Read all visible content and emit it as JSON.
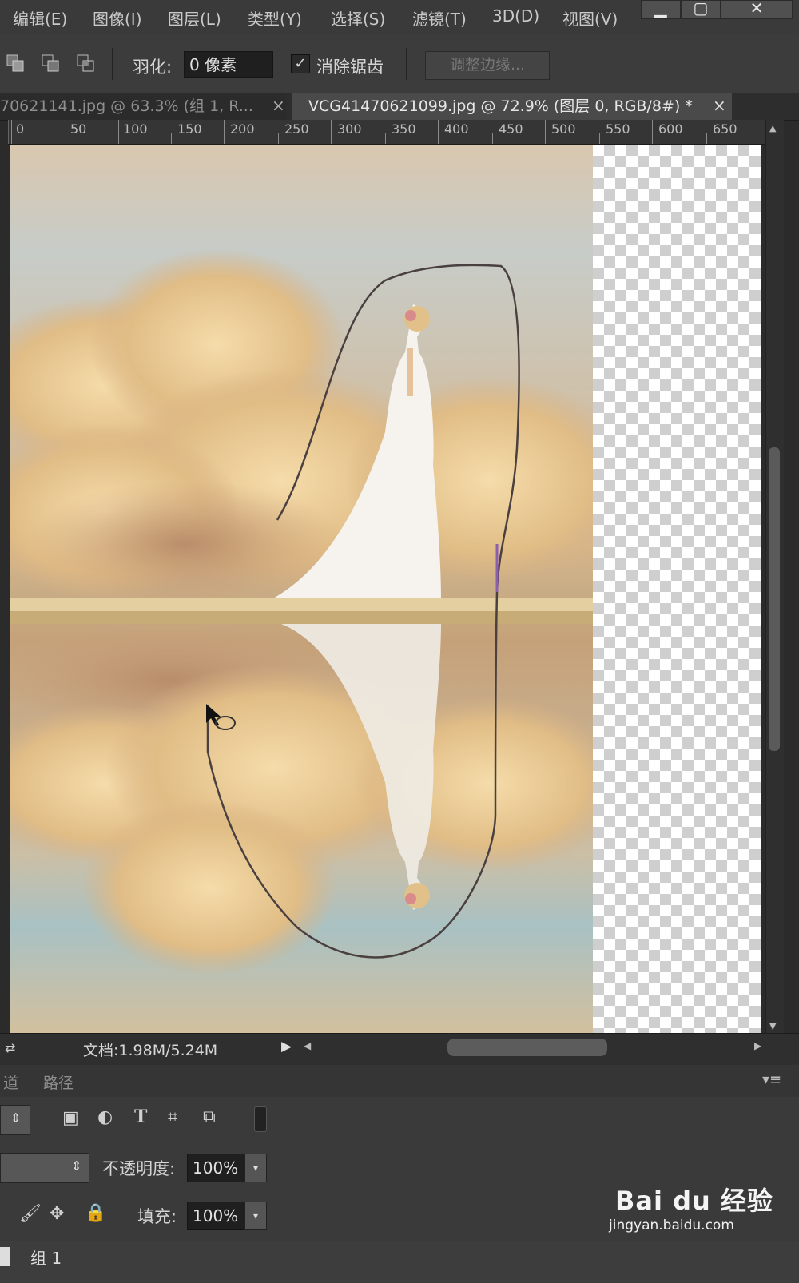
{
  "menu": [
    "编辑(E)",
    "图像(I)",
    "图层(L)",
    "类型(Y)",
    "选择(S)",
    "滤镜(T)",
    "3D(D)",
    "视图(V)"
  ],
  "options": {
    "feather_label": "羽化:",
    "feather_value": "0 像素",
    "antialias_label": "消除锯齿",
    "antialias_checked": true,
    "refine_edge_label": "调整边缘..."
  },
  "tabs": [
    {
      "title": "70621141.jpg @ 63.3% (组 1, R...",
      "close": "×",
      "active": false
    },
    {
      "title": "VCG41470621099.jpg @ 72.9% (图层 0, RGB/8#) *",
      "close": "×",
      "active": true
    }
  ],
  "ruler": {
    "labels": [
      "0",
      "50",
      "100",
      "150",
      "200",
      "250",
      "300",
      "350",
      "400",
      "450",
      "500",
      "550",
      "600",
      "650"
    ]
  },
  "status": {
    "doc_info": "文档:1.98M/5.24M"
  },
  "panels": {
    "tabs": [
      "道",
      "路径"
    ],
    "opacity_label": "不透明度:",
    "opacity_value": "100%",
    "fill_label": "填充:",
    "fill_value": "100%"
  },
  "layers": [
    {
      "name": "组 1"
    }
  ],
  "watermark": {
    "brand": "Bai du 经验",
    "url": "jingyan.baidu.com"
  },
  "colors": {
    "accent": "#8a5fb0",
    "panel": "#3a3a3a"
  }
}
